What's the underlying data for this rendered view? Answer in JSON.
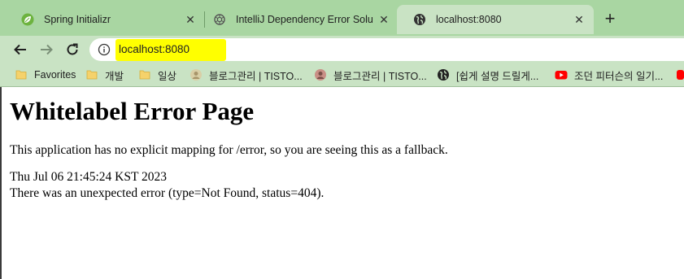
{
  "tabs": [
    {
      "title": "Spring Initializr",
      "icon": "spring-leaf-icon"
    },
    {
      "title": "IntelliJ Dependency Error Solutio",
      "icon": "openai-icon"
    },
    {
      "title": "localhost:8080",
      "icon": "globe-icon"
    }
  ],
  "toolbar": {
    "url": "localhost:8080"
  },
  "bookmarks": [
    {
      "label": "Favorites",
      "icon": "folder-icon"
    },
    {
      "label": "개발",
      "icon": "folder-icon"
    },
    {
      "label": "일상",
      "icon": "folder-icon"
    },
    {
      "label": "블로그관리 | TISTO...",
      "icon": "blog-avatar-icon"
    },
    {
      "label": "블로그관리 | TISTO...",
      "icon": "blog-avatar-icon"
    },
    {
      "label": "[쉽게 설명 드릴게...",
      "icon": "globe-icon"
    },
    {
      "label": "조던 피터슨의 일기...",
      "icon": "youtube-icon"
    }
  ],
  "page": {
    "heading": "Whitelabel Error Page",
    "message": "This application has no explicit mapping for /error, so you are seeing this as a fallback.",
    "timestamp": "Thu Jul 06 21:45:24 KST 2023",
    "error_detail": "There was an unexpected error (type=Not Found, status=404)."
  },
  "colors": {
    "tabstrip": "#a9d6a2",
    "toolbar": "#c9e3c4",
    "url_highlight": "#ffff00"
  }
}
